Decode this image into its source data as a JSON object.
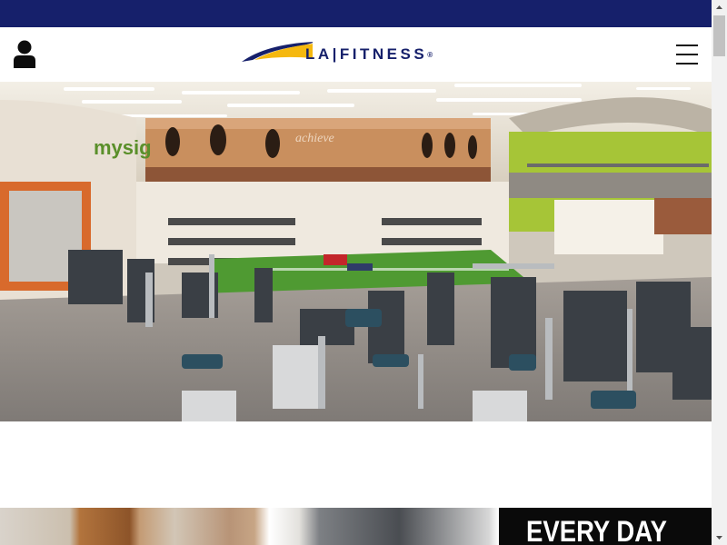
{
  "header": {
    "logo_text": "LA|FITNESS",
    "logo_mark": "®",
    "account_icon": "user-icon",
    "menu_icon": "hamburger-menu-icon"
  },
  "hero": {
    "image": "gym-interior-photo",
    "banner_text": "achieve"
  },
  "promo": {
    "headline": "EVERY DAY"
  },
  "scrollbar": {
    "up_icon": "scroll-up-arrow-icon",
    "down_icon": "scroll-down-arrow-icon"
  },
  "colors": {
    "brand_navy": "#16206b",
    "brand_yellow": "#f5b80f",
    "promo_black": "#0a0a0a"
  }
}
